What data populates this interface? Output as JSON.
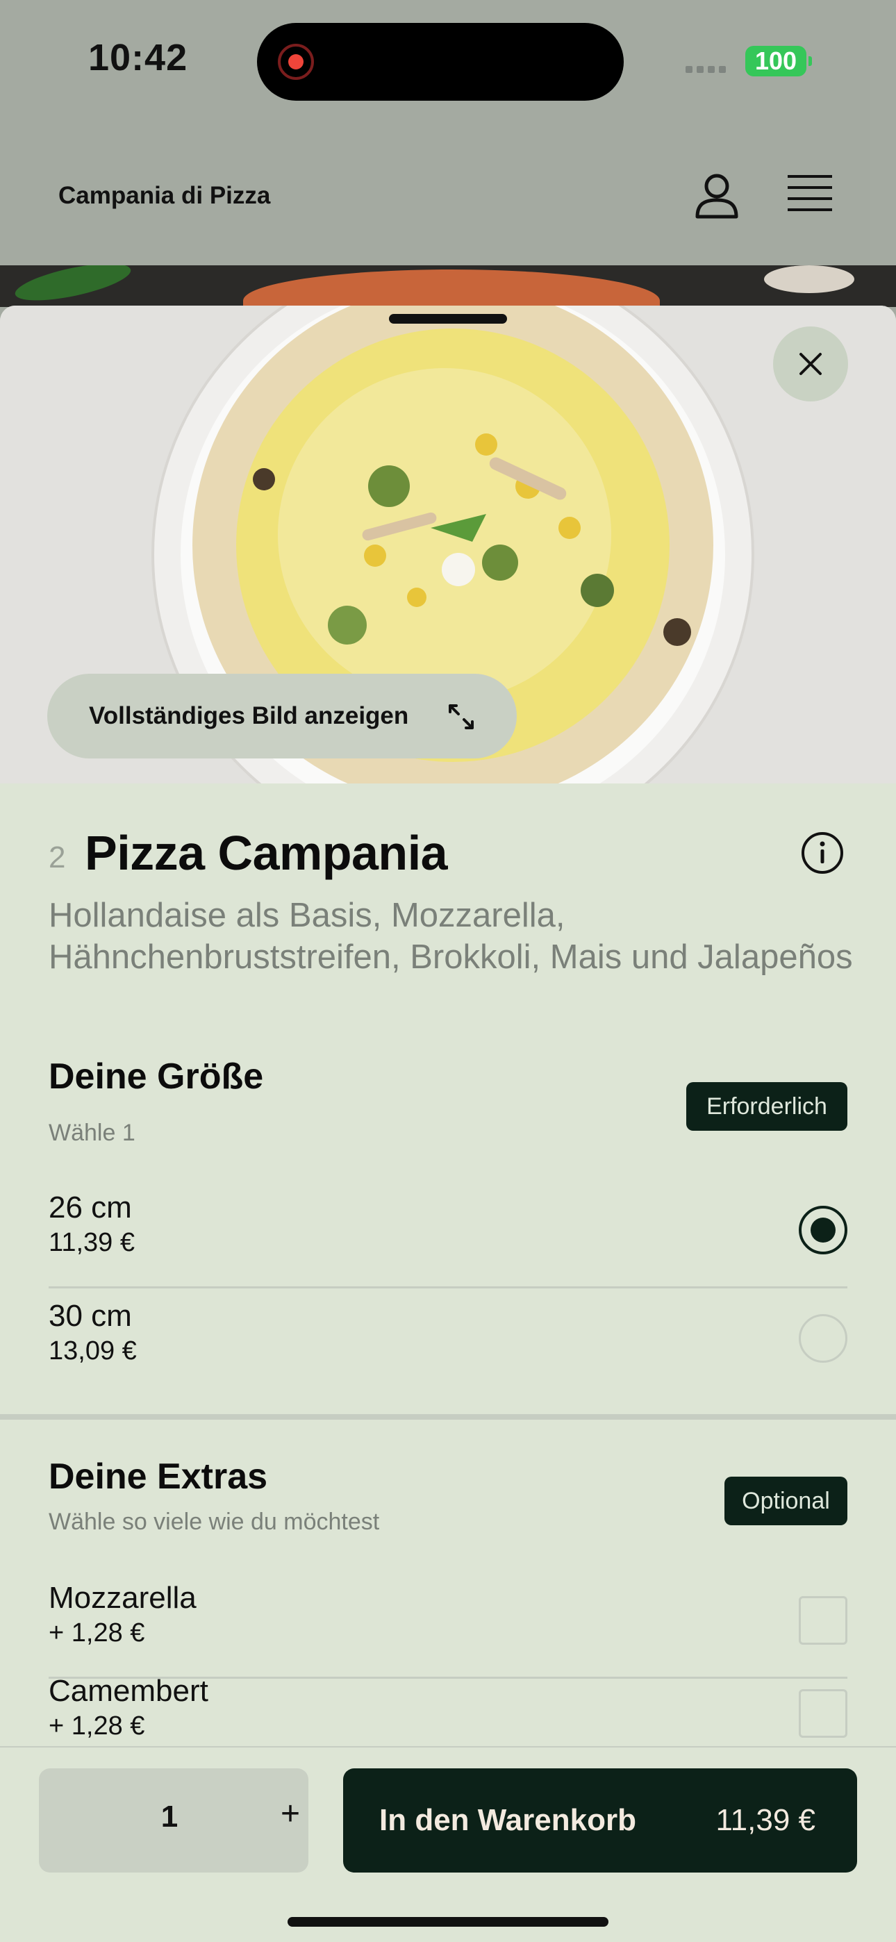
{
  "status_bar": {
    "time": "10:42",
    "battery": "100"
  },
  "header": {
    "brand": "Campania di Pizza"
  },
  "hero": {
    "view_full_image_label": "Vollständiges Bild anzeigen"
  },
  "product": {
    "number": "2",
    "name": "Pizza Campania",
    "description": "Hollandaise als Basis, Mozzarella, Hähnchenbruststreifen, Brokkoli, Mais und Jalapeños"
  },
  "size_section": {
    "title": "Deine Größe",
    "subtitle": "Wähle 1",
    "tag": "Erforderlich",
    "options": [
      {
        "name": "26 cm",
        "price": "11,39 €",
        "selected": true
      },
      {
        "name": "30 cm",
        "price": "13,09 €",
        "selected": false
      }
    ]
  },
  "extras_section": {
    "title": "Deine Extras",
    "subtitle": "Wähle so viele wie du möchtest",
    "tag": "Optional",
    "options": [
      {
        "name": "Mozzarella",
        "price": "+ 1,28 €",
        "checked": false
      },
      {
        "name": "Camembert",
        "price": "+ 1,28 €",
        "checked": false
      }
    ]
  },
  "bottom_bar": {
    "quantity": "1",
    "plus_label": "+",
    "add_to_cart_label": "In den Warenkorb",
    "total": "11,39 €"
  },
  "colors": {
    "dark_green": "#0c2118",
    "sheet_bg": "#dde5d5",
    "accent_gray": "#c9d0c4"
  }
}
